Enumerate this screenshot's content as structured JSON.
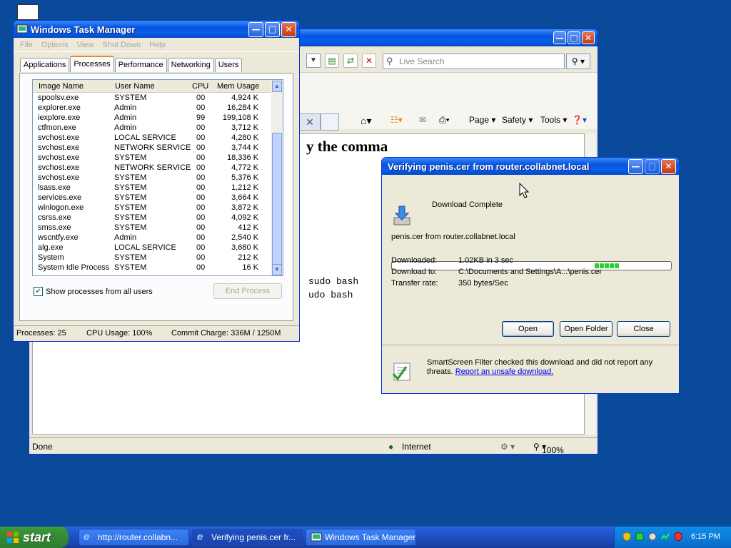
{
  "ie": {
    "search_placeholder": "Live Search",
    "cmd_page": "Page",
    "cmd_safety": "Safety",
    "cmd_tools": "Tools",
    "heading_fragment": "y the comma",
    "code_line1": "sudo bash",
    "code_line2": "udo bash",
    "status_done": "Done",
    "status_zone": "Internet",
    "status_zoom": "100%"
  },
  "task_manager": {
    "title": "Windows Task Manager",
    "menu": [
      "File",
      "Options",
      "View",
      "Shut Down",
      "Help"
    ],
    "tabs": [
      "Applications",
      "Processes",
      "Performance",
      "Networking",
      "Users"
    ],
    "selected_tab": "Processes",
    "columns": [
      "Image Name",
      "User Name",
      "CPU",
      "Mem Usage"
    ],
    "processes": [
      {
        "image": "spoolsv.exe",
        "user": "SYSTEM",
        "cpu": "00",
        "mem": "4,924 K"
      },
      {
        "image": "explorer.exe",
        "user": "Admin",
        "cpu": "00",
        "mem": "16,284 K"
      },
      {
        "image": "iexplore.exe",
        "user": "Admin",
        "cpu": "99",
        "mem": "199,108 K"
      },
      {
        "image": "ctfmon.exe",
        "user": "Admin",
        "cpu": "00",
        "mem": "3,712 K"
      },
      {
        "image": "svchost.exe",
        "user": "LOCAL SERVICE",
        "cpu": "00",
        "mem": "4,280 K"
      },
      {
        "image": "svchost.exe",
        "user": "NETWORK SERVICE",
        "cpu": "00",
        "mem": "3,744 K"
      },
      {
        "image": "svchost.exe",
        "user": "SYSTEM",
        "cpu": "00",
        "mem": "18,336 K"
      },
      {
        "image": "svchost.exe",
        "user": "NETWORK SERVICE",
        "cpu": "00",
        "mem": "4,772 K"
      },
      {
        "image": "svchost.exe",
        "user": "SYSTEM",
        "cpu": "00",
        "mem": "5,376 K"
      },
      {
        "image": "lsass.exe",
        "user": "SYSTEM",
        "cpu": "00",
        "mem": "1,212 K"
      },
      {
        "image": "services.exe",
        "user": "SYSTEM",
        "cpu": "00",
        "mem": "3,664 K"
      },
      {
        "image": "winlogon.exe",
        "user": "SYSTEM",
        "cpu": "00",
        "mem": "3,872 K"
      },
      {
        "image": "csrss.exe",
        "user": "SYSTEM",
        "cpu": "00",
        "mem": "4,092 K"
      },
      {
        "image": "smss.exe",
        "user": "SYSTEM",
        "cpu": "00",
        "mem": "412 K"
      },
      {
        "image": "wscntfy.exe",
        "user": "Admin",
        "cpu": "00",
        "mem": "2,540 K"
      },
      {
        "image": "alg.exe",
        "user": "LOCAL SERVICE",
        "cpu": "00",
        "mem": "3,680 K"
      },
      {
        "image": "System",
        "user": "SYSTEM",
        "cpu": "00",
        "mem": "212 K"
      },
      {
        "image": "System Idle Process",
        "user": "SYSTEM",
        "cpu": "00",
        "mem": "16 K"
      }
    ],
    "show_all_users_label": "Show processes from all users",
    "show_all_users_checked": true,
    "end_process_label": "End Process",
    "status_processes": "Processes: 25",
    "status_cpu": "CPU Usage: 100%",
    "status_commit": "Commit Charge: 336M / 1250M"
  },
  "download": {
    "title": "Verifying penis.cer from router.collabnet.local",
    "complete_text": "Download Complete",
    "file_line": "penis.cer from router.collabnet.local",
    "downloaded_label": "Downloaded:",
    "downloaded_value": "1.02KB in 3 sec",
    "download_to_label": "Download to:",
    "download_to_value": "C:\\Documents and Settings\\A...\\penis.cer",
    "transfer_rate_label": "Transfer rate:",
    "transfer_rate_value": "350 bytes/Sec",
    "open_label": "Open",
    "open_folder_label": "Open Folder",
    "close_label": "Close",
    "smartscreen_text": "SmartScreen Filter checked this download and did not report any",
    "smartscreen_text2": "threats.",
    "report_link": "Report an unsafe download."
  },
  "taskbar": {
    "start_label": "start",
    "buttons": [
      "http://router.collabn...",
      "Verifying penis.cer fr...",
      "Windows Task Manager"
    ],
    "clock": "6:15 PM"
  }
}
